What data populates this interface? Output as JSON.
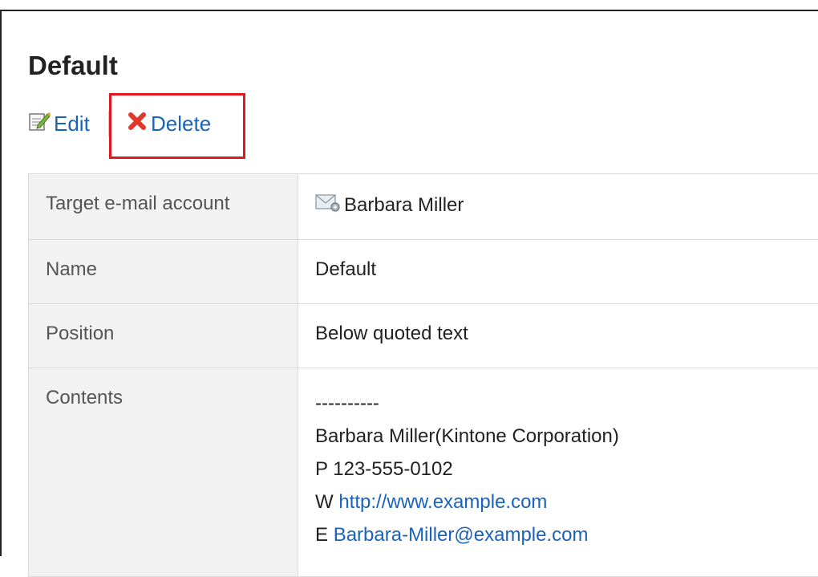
{
  "page": {
    "title": "Default"
  },
  "actions": {
    "edit_label": "Edit",
    "edit_icon": "edit-pencil-icon",
    "delete_label": "Delete",
    "delete_icon": "delete-x-icon",
    "highlight_color": "#e3181f"
  },
  "details": {
    "rows": [
      {
        "label": "Target e-mail account",
        "value": "Barbara Miller",
        "icon": "mail-account-settings-icon"
      },
      {
        "label": "Name",
        "value": "Default"
      },
      {
        "label": "Position",
        "value": "Below quoted text"
      },
      {
        "label": "Contents"
      }
    ],
    "signature": {
      "separator": "----------",
      "company_line": "Barbara Miller(Kintone Corporation)",
      "phone_line": "P 123-555-0102",
      "web_prefix": "W ",
      "web_url": "http://www.example.com",
      "email_prefix": "E ",
      "email_address": "Barbara-Miller@example.com"
    }
  },
  "colors": {
    "link": "#1a63b8",
    "label_bg": "#f2f2f2",
    "border": "#dcdcdc"
  }
}
